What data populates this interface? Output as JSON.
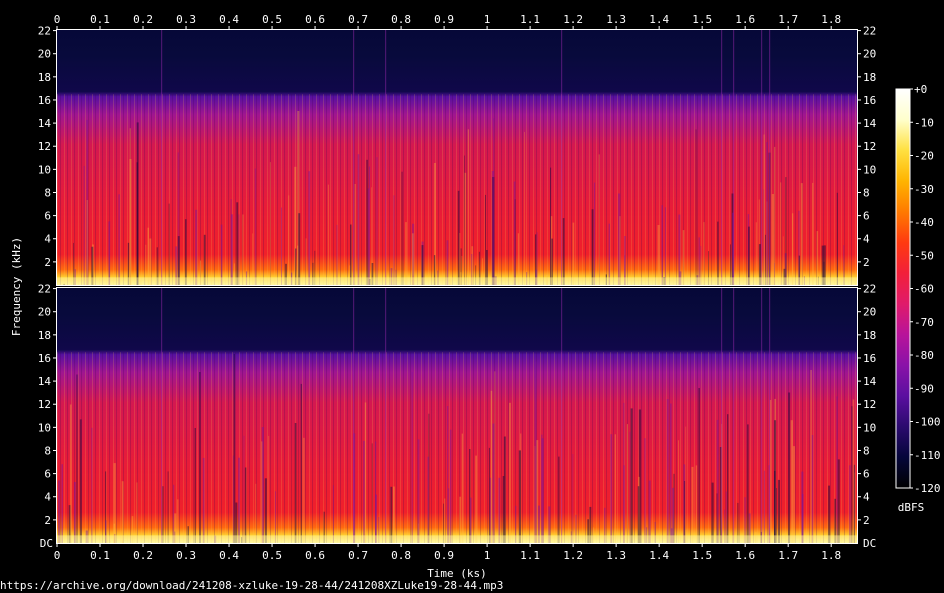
{
  "url": "https://archive.org/download/241208-xzluke-19-28-44/241208XZLuke19-28-44.mp3",
  "chart_data": {
    "type": "heatmap",
    "kind": "spectrogram",
    "channels": 2,
    "xlabel": "Time (ks)",
    "ylabel": "Frequency (kHz)",
    "xlim": [
      0,
      1.86
    ],
    "x_ticks": [
      "0",
      "0.1",
      "0.2",
      "0.3",
      "0.4",
      "0.5",
      "0.6",
      "0.7",
      "0.8",
      "0.9",
      "1",
      "1.1",
      "1.2",
      "1.3",
      "1.4",
      "1.5",
      "1.6",
      "1.7",
      "1.8"
    ],
    "ylim": [
      0,
      22.05
    ],
    "y_ticks": [
      "2",
      "4",
      "6",
      "8",
      "10",
      "12",
      "14",
      "16",
      "18",
      "20",
      "22"
    ],
    "y_bottom_label_last_channel": "DC",
    "lowpass_cutoff_khz": 16.5,
    "colorbar": {
      "label": "dBFS",
      "ticks": [
        "+0",
        "-10",
        "-20",
        "-30",
        "-40",
        "-50",
        "-60",
        "-70",
        "-80",
        "-90",
        "-100",
        "-110",
        "-120"
      ],
      "range": [
        -120,
        0
      ],
      "colors": [
        "#000000",
        "#05063a",
        "#2b0a6e",
        "#5b0fa0",
        "#8a12a8",
        "#b8139a",
        "#e01a6a",
        "#f2203a",
        "#ff3a10",
        "#ff7a00",
        "#ffb400",
        "#ffe040",
        "#ffffcc",
        "#ffffff"
      ]
    },
    "grid": false
  }
}
